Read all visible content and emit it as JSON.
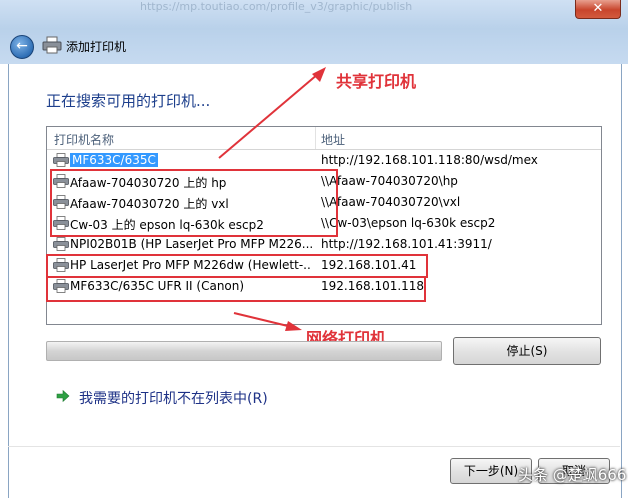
{
  "window": {
    "title": "添加打印机",
    "close_label": "✕",
    "url_text": "https://mp.toutiao.com/profile_v3/graphic/publish"
  },
  "heading": "正在搜索可用的打印机...",
  "list": {
    "columns": {
      "name": "打印机名称",
      "address": "地址"
    },
    "rows": [
      {
        "name": "MF633C/635C",
        "address": "http://192.168.101.118:80/wsd/mex",
        "selected": true
      },
      {
        "name": "Afaaw-704030720 上的 hp",
        "address": "\\\\Afaaw-704030720\\hp",
        "selected": false
      },
      {
        "name": "Afaaw-704030720 上的 vxl",
        "address": "\\\\Afaaw-704030720\\vxl",
        "selected": false
      },
      {
        "name": "Cw-03 上的 epson lq-630k escp2",
        "address": "\\\\Cw-03\\epson lq-630k escp2",
        "selected": false
      },
      {
        "name": "NPI02B01B (HP LaserJet Pro MFP M226...",
        "address": "http://192.168.101.41:3911/",
        "selected": false
      },
      {
        "name": "HP LaserJet Pro MFP M226dw (Hewlett-...",
        "address": "192.168.101.41",
        "selected": false
      },
      {
        "name": "MF633C/635C UFR II (Canon)",
        "address": "192.168.101.118",
        "selected": false
      }
    ]
  },
  "annotations": {
    "shared_label": "共享打印机",
    "network_label": "网络打印机",
    "color": "#e0333a"
  },
  "buttons": {
    "stop": "停止(S)",
    "next": "下一步(N)",
    "cancel": "取消"
  },
  "not_listed": "我需要的打印机不在列表中(R)",
  "watermark": "头条 @楚飒666",
  "icons": {
    "back": "back-arrow-icon",
    "printer": "printer-icon",
    "link_arrow": "green-arrow-icon"
  }
}
